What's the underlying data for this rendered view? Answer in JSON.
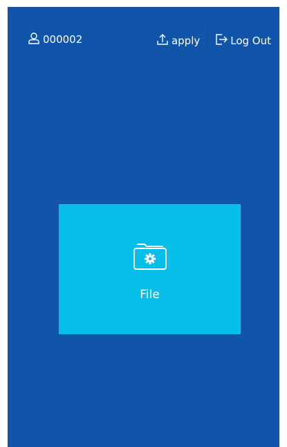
{
  "header": {
    "user_id": "000002",
    "apply_label": "apply",
    "logout_label": "Log Out"
  },
  "tile": {
    "label": "File",
    "icon": "folder-gear-icon"
  },
  "colors": {
    "background": "#1155aa",
    "tile": "#07bfe8",
    "text": "#ffffff"
  }
}
